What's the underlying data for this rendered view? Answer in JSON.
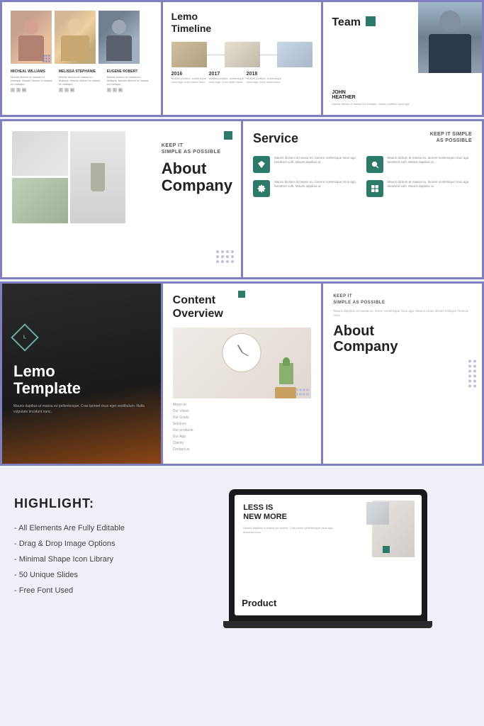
{
  "top": {
    "card1": {
      "people": [
        {
          "name": "MICHEAL WILLIAMS",
          "desc": "Mauris dictum ut massa eu tristique. Mauris dictum ut massa eu tristique."
        },
        {
          "name": "MELISSA STEPHANIE",
          "desc": "Mauris dictum ut massa eu tristique. Mauris dictum ut massa eu tristique."
        },
        {
          "name": "EUGENE ROBERT",
          "desc": "Mauris dictum ut massa eu tristique. Mauris dictum ut massa eu tristique."
        }
      ]
    },
    "card2": {
      "title": "Lemo\nTimeline",
      "years": [
        {
          "year": "2016",
          "desc": "Nullam porttitor. scelerisque risus aga. nunc etiam risus."
        },
        {
          "year": "2017",
          "desc": "Nullam porttitor. scelerisque risus aga. nunc etiam risus."
        },
        {
          "year": "2018",
          "desc": "Nullam porttitor. scelerisque risus aga. nunc etiam risus."
        }
      ]
    },
    "card3": {
      "title": "Team",
      "name": "JOHN\nHEATHER",
      "desc": "Mauris dictum ut massa eu tristique. nullam porttitor risus ega."
    }
  },
  "middle": {
    "about": {
      "small_text": "KEEP IT\nSIMPLE AS POSSIBLE",
      "title": "About\nCompany"
    },
    "service": {
      "title": "Service",
      "subtitle": "KEEP IT SIMPLE\nAS POSSIBLE",
      "items": [
        {
          "icon": "diamond",
          "text": "Mauris dicitum at massa eu. laorere scelerisque risus aga hendrerit vulh. Mauris dapibus ut."
        },
        {
          "icon": "search",
          "text": "Mauris dicitum at massa eu. laorere scelerisque risus aga hendrerit vulh. Mauris dapibus ut."
        },
        {
          "icon": "gear",
          "text": "Mauris dicitum at massa eu. laorere scelerisque risus aga hendrerit vulh. Mauris dapibus ut."
        },
        {
          "icon": "settings2",
          "text": "Mauris dicitum at massa eu. laorere scelerisque risus aga hendrerit vulh. Mauris dapibus ut."
        }
      ]
    }
  },
  "bottom": {
    "lemo": {
      "letter": "L",
      "title": "Lemo\nTemplate",
      "desc": "Mauris dapibus ut massa eu pellentesque. Cras laoreet risus eget vestibulum. Nulla vulputate tincidunt nunc."
    },
    "content": {
      "title": "Content\nOverview",
      "menu": [
        "About us",
        "Our Vision",
        "Our Goals",
        "Services",
        "Our products",
        "Our App",
        "Clients",
        "Contact us"
      ]
    },
    "about_right": {
      "small_text": "KEEP IT\nSIMPLE AS POSSIBLE",
      "desc": "Mauris dapibus ut massa eu. lorem scelerisque risus aga. Mauris urnas dictum tristique rhoncus nunc.",
      "title": "About\nCompany"
    }
  },
  "highlight": {
    "title": "HIGHLIGHT:",
    "items": [
      "- All Elements Are Fully Editable",
      "- Drag & Drop Image Options",
      "- Minimal Shape Icon Library",
      "- 50 Unique Slides",
      "- Free Font Used"
    ],
    "laptop": {
      "screen_title": "LESS IS\nNEW MORE",
      "screen_text": "Mauris dapibus ut massa eu laoreet. Cras lorem pellentesque risus aga. tincidunt nunc.",
      "product_label": "Product"
    }
  }
}
